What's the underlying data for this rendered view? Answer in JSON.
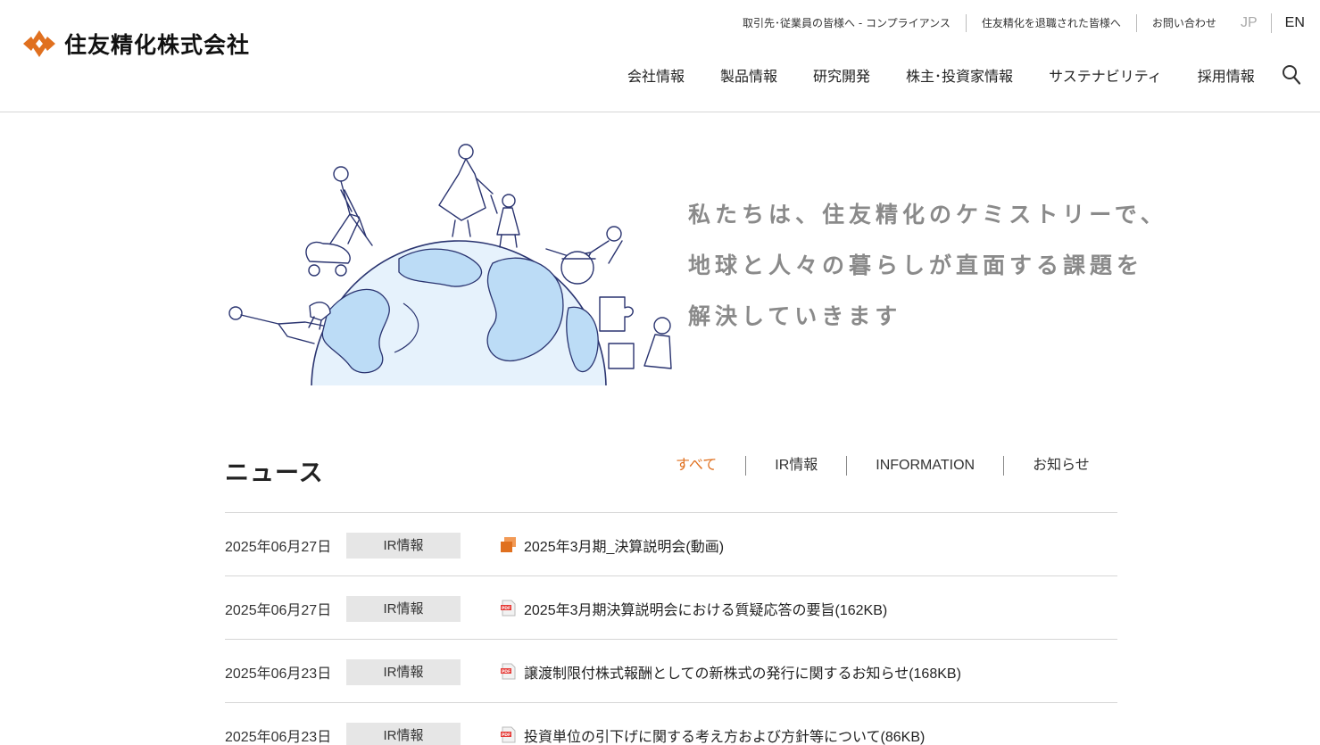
{
  "brand": {
    "name": "住友精化株式会社",
    "accent_color": "#e0701f"
  },
  "header": {
    "utility_links": [
      {
        "label": "取引先･従業員の皆様へ - コンプライアンス"
      },
      {
        "label": "住友精化を退職された皆様へ"
      },
      {
        "label": "お問い合わせ"
      }
    ],
    "languages": {
      "jp": "JP",
      "en": "EN"
    },
    "main_nav": [
      {
        "label": "会社情報"
      },
      {
        "label": "製品情報"
      },
      {
        "label": "研究開発"
      },
      {
        "label": "株主･投資家情報"
      },
      {
        "label": "サステナビリティ"
      },
      {
        "label": "採用情報"
      }
    ],
    "search_icon": "search-icon"
  },
  "hero": {
    "lines": [
      "私たちは、住友精化のケミストリーで、",
      "地球と人々の暮らしが直面する課題を",
      "解決していきます"
    ]
  },
  "news": {
    "title": "ニュース",
    "tabs": [
      {
        "label": "すべて",
        "active": true
      },
      {
        "label": "IR情報",
        "active": false
      },
      {
        "label": "INFORMATION",
        "active": false
      },
      {
        "label": "お知らせ",
        "active": false
      }
    ],
    "items": [
      {
        "date": "2025年06月27日",
        "category": "IR情報",
        "icon": "video-icon",
        "title": "2025年3月期_決算説明会(動画)"
      },
      {
        "date": "2025年06月27日",
        "category": "IR情報",
        "icon": "pdf-icon",
        "title": "2025年3月期決算説明会における質疑応答の要旨(162KB)"
      },
      {
        "date": "2025年06月23日",
        "category": "IR情報",
        "icon": "pdf-icon",
        "title": "譲渡制限付株式報酬としての新株式の発行に関するお知らせ(168KB)"
      },
      {
        "date": "2025年06月23日",
        "category": "IR情報",
        "icon": "pdf-icon",
        "title": "投資単位の引下げに関する考え方および方針等について(86KB)"
      }
    ]
  }
}
